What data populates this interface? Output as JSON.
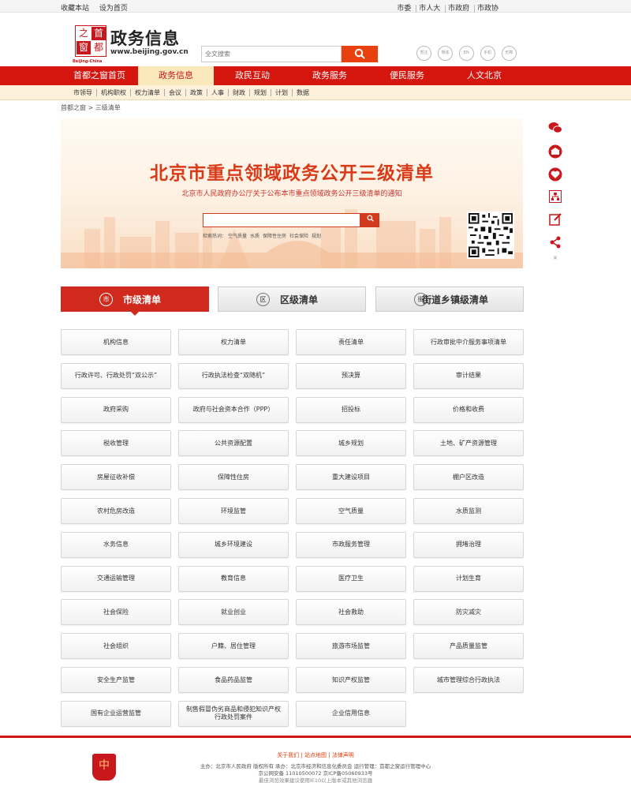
{
  "topbar": {
    "left": [
      "收藏本站",
      "设为首页"
    ],
    "right": [
      "市委",
      "市人大",
      "市政府",
      "市政协"
    ]
  },
  "header": {
    "logo_chars": [
      "之",
      "首",
      "窗",
      "都"
    ],
    "logo_sub": "Beijing-China",
    "title": "政务信息",
    "url": "www.beijing.gov.cn",
    "search_placeholder": "全文搜索",
    "search_icon": "search-icon",
    "tools": [
      "暂注",
      "简体",
      "EN",
      "手机",
      "无障"
    ]
  },
  "mainnav": [
    "首都之窗首页",
    "政务信息",
    "政民互动",
    "政务服务",
    "便民服务",
    "人文北京"
  ],
  "mainnav_active": "政务信息",
  "subnav": [
    "市领导",
    "机构职权",
    "权力清单",
    "会议",
    "政策",
    "人事",
    "财政",
    "规划",
    "计划",
    "数据"
  ],
  "breadcrumb": [
    "首都之窗",
    "三级清单"
  ],
  "banner": {
    "title": "北京市重点领域政务公开三级清单",
    "subtitle": "北京市人民政府办公厅关于公布本市重点领域政务公开三级清单的通知",
    "hot_label": "检索热词：",
    "hot_words": [
      "空气质量",
      "水质",
      "保障性住房",
      "社会保险",
      "规划"
    ]
  },
  "tabs": [
    {
      "icon_char": "市",
      "label": "市级清单",
      "active": true
    },
    {
      "icon_char": "区",
      "label": "区级清单",
      "active": false
    },
    {
      "icon_char": "街",
      "label": "街道乡镇级清单",
      "active": false
    }
  ],
  "items": [
    "机构信息",
    "权力清单",
    "责任清单",
    "行政审批中介服务事项清单",
    "行政许可、行政处罚“双公示”",
    "行政执法检查“双随机”",
    "预决算",
    "审计结果",
    "政府采购",
    "政府与社会资本合作（PPP）",
    "招投标",
    "价格和收费",
    "税收管理",
    "公共资源配置",
    "城乡规划",
    "土地、矿产资源管理",
    "房屋征收补偿",
    "保障性住房",
    "重大建设项目",
    "棚户区改造",
    "农村危房改造",
    "环境监管",
    "空气质量",
    "水质监测",
    "水务信息",
    "城乡环境建设",
    "市政服务管理",
    "拥堵治理",
    "交通运输管理",
    "教育信息",
    "医疗卫生",
    "计划生育",
    "社会保险",
    "就业创业",
    "社会救助",
    "防灾减灾",
    "社会组织",
    "户籍、居住管理",
    "旅游市场监管",
    "产品质量监管",
    "安全生产监管",
    "食品药品监管",
    "知识产权监管",
    "城市管理综合行政执法",
    "国有企业运营监管",
    "制售假冒伪劣商品和侵犯知识产权行政处罚案件",
    "企业信用信息"
  ],
  "side_tools": [
    "wechat-icon",
    "building-icon",
    "heart-icon",
    "sitemap-icon",
    "edit-icon",
    "share-icon"
  ],
  "footer": {
    "links": [
      "关于我们",
      "站点地图",
      "法律声明"
    ],
    "line1": "主办：北京市人民政府  版权所有  承办：北京市经济和信息化委员会  运行管理：首都之窗运行管理中心",
    "line2": "京公网安备 11010500072  京ICP备05060933号",
    "line3": "最佳浏览效果建议使用IE10以上版本或其他浏览器"
  },
  "colors": {
    "brand_red": "#d4160f",
    "accent_orange": "#e8410e",
    "nav_active_bg": "#fbe8bb"
  }
}
